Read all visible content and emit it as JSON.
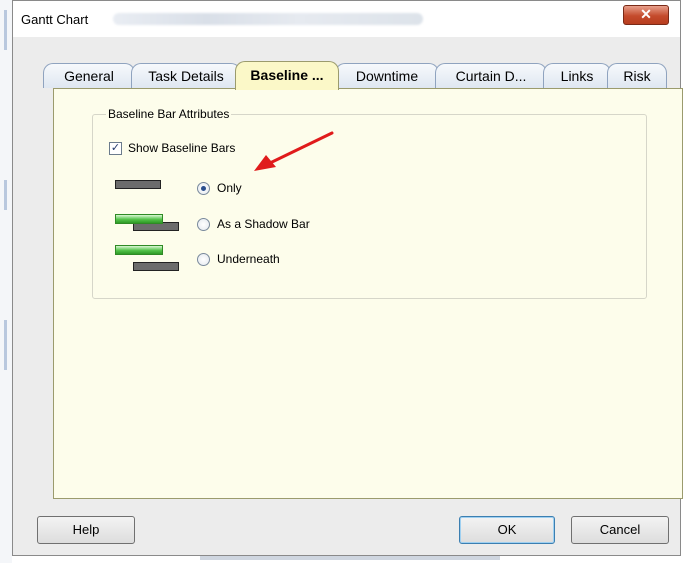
{
  "window": {
    "title": "Gantt Chart",
    "close_icon": "✕"
  },
  "tabs": [
    {
      "label": "General",
      "active": false
    },
    {
      "label": "Task Details",
      "active": false
    },
    {
      "label": "Baseline ...",
      "active": true
    },
    {
      "label": "Downtime",
      "active": false
    },
    {
      "label": "Curtain D...",
      "active": false
    },
    {
      "label": "Links",
      "active": false
    },
    {
      "label": "Risk",
      "active": false
    }
  ],
  "baseline_group": {
    "label": "Baseline Bar Attributes",
    "show_baseline_bars": {
      "label": "Show Baseline Bars",
      "checked": true
    },
    "options": [
      {
        "label": "Only",
        "selected": true
      },
      {
        "label": "As a Shadow Bar",
        "selected": false
      },
      {
        "label": "Underneath",
        "selected": false
      }
    ]
  },
  "buttons": {
    "help": "Help",
    "ok": "OK",
    "cancel": "Cancel"
  },
  "colors": {
    "active_tab": "#fbf8c8",
    "panel_bg": "#fdfdeb",
    "arrow": "#e01b1b",
    "baseline_bar": "#6c6c6c",
    "task_bar": "#53c34a"
  }
}
